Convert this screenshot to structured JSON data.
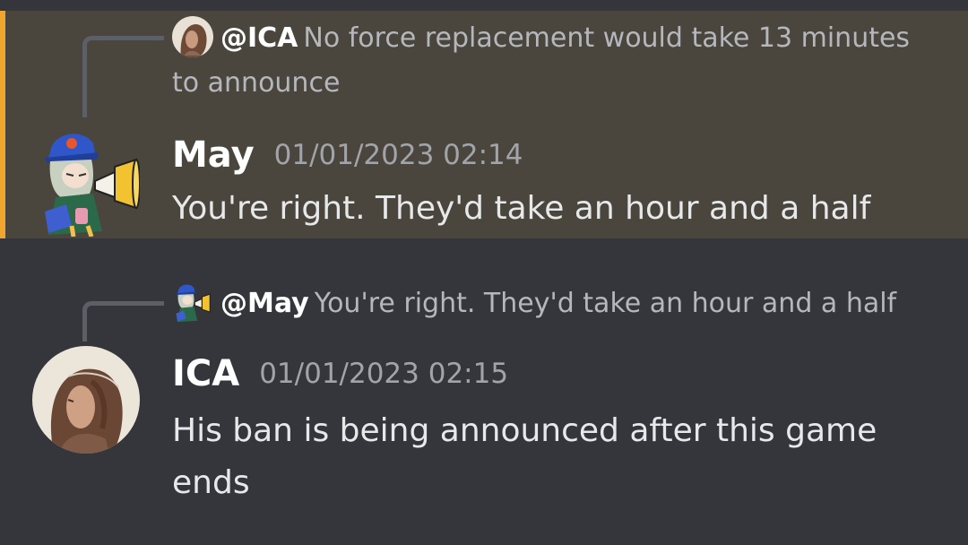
{
  "theme": {
    "highlight_accent": "#f0a52c",
    "mention_bg": "#4a463e",
    "base_bg": "#35363c"
  },
  "messages": [
    {
      "reply": {
        "mention": "@ICA",
        "text": "No force replacement would take 13 minutes to announce",
        "avatar_icon": "portrait-avatar-icon"
      },
      "author": "May",
      "timestamp": "01/01/2023 02:14",
      "content": "You're right. They'd take an hour and a half",
      "avatar_icon": "megaphone-character-avatar-icon",
      "highlighted": true
    },
    {
      "reply": {
        "mention": "@May",
        "text": "You're right. They'd take an hour and a half",
        "avatar_icon": "megaphone-character-avatar-icon"
      },
      "author": "ICA",
      "timestamp": "01/01/2023 02:15",
      "content": "His ban is being announced after this game ends",
      "avatar_icon": "portrait-avatar-icon",
      "highlighted": false
    }
  ]
}
